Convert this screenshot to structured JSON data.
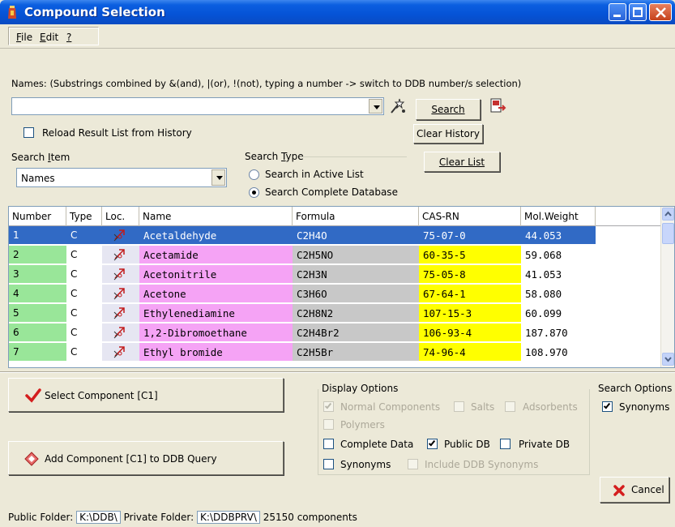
{
  "window": {
    "title": "Compound Selection"
  },
  "menu": {
    "file": "File",
    "edit": "Edit",
    "help": "?"
  },
  "search": {
    "names_label": "Names: (Substrings combined by &(and), |(or), !(not), typing a number -> switch to DDB number/s selection)",
    "names_value": "",
    "search_button": "Search",
    "clear_history_button": "Clear History",
    "clear_list_button": "Clear List",
    "reload_label": "Reload Result List from History",
    "reload_checked": false,
    "search_item_label": "Search Item",
    "search_item_value": "Names",
    "search_type_label": "Search Type",
    "search_type_active": "Search in  Active List",
    "search_type_complete": "Search Complete Database",
    "search_type_selected": "complete"
  },
  "table": {
    "columns": [
      "Number",
      "Type",
      "Loc.",
      "Name",
      "Formula",
      "CAS-RN",
      "Mol.Weight"
    ],
    "rows": [
      {
        "number": "1",
        "type": "C",
        "name": "Acetaldehyde",
        "formula": "C2H4O",
        "cas": "75-07-0",
        "mw": "44.053",
        "selected": true
      },
      {
        "number": "2",
        "type": "C",
        "name": "Acetamide",
        "formula": "C2H5NO",
        "cas": "60-35-5",
        "mw": "59.068",
        "selected": false
      },
      {
        "number": "3",
        "type": "C",
        "name": "Acetonitrile",
        "formula": "C2H3N",
        "cas": "75-05-8",
        "mw": "41.053",
        "selected": false
      },
      {
        "number": "4",
        "type": "C",
        "name": "Acetone",
        "formula": "C3H6O",
        "cas": "67-64-1",
        "mw": "58.080",
        "selected": false
      },
      {
        "number": "5",
        "type": "C",
        "name": "Ethylenediamine",
        "formula": "C2H8N2",
        "cas": "107-15-3",
        "mw": "60.099",
        "selected": false
      },
      {
        "number": "6",
        "type": "C",
        "name": "1,2-Dibromoethane",
        "formula": "C2H4Br2",
        "cas": "106-93-4",
        "mw": "187.870",
        "selected": false
      },
      {
        "number": "7",
        "type": "C",
        "name": "Ethyl bromide",
        "formula": "C2H5Br",
        "cas": "74-96-4",
        "mw": "108.970",
        "selected": false
      }
    ],
    "colors": {
      "number_bg": "#99e699",
      "type_bg": "#ffffff",
      "loc_bg": "#e6e6f2",
      "name_bg": "#f5a3f5",
      "formula_bg": "#c8c8c8",
      "cas_bg": "#ffff00",
      "mw_bg": "#ffffff",
      "selected_bg": "#316ac5"
    }
  },
  "actions": {
    "select_component": "Select Component [C1]",
    "add_component": "Add Component [C1] to DDB Query",
    "cancel": "Cancel"
  },
  "display_options": {
    "title": "Display Options",
    "normal_components": "Normal Components",
    "salts": "Salts",
    "adsorbents": "Adsorbents",
    "polymers": "Polymers",
    "complete_data": "Complete Data",
    "public_db": "Public DB",
    "private_db": "Private DB",
    "synonyms": "Synonyms",
    "include_ddb_synonyms": "Include DDB Synonyms"
  },
  "search_options": {
    "title": "Search Options",
    "synonyms": "Synonyms"
  },
  "status": {
    "public_folder_label": "Public Folder:",
    "public_folder": "K:\\DDB\\",
    "private_folder_label": "Private Folder:",
    "private_folder": "K:\\DDBPRV\\",
    "count": "25150 components"
  }
}
